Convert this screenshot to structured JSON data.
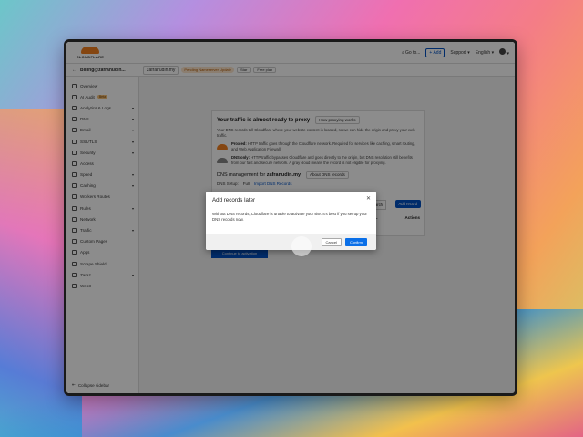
{
  "header": {
    "brand": "CLOUDFLARE",
    "goto": "Go to...",
    "add": "+ Add",
    "support": "Support",
    "language": "English"
  },
  "subbar": {
    "account": "Billing@zafranudin...",
    "zone": "zafranudin.my",
    "status": "Pending Nameserver Update",
    "star": "Star",
    "plan": "Free plan"
  },
  "sidebar": {
    "items": [
      {
        "label": "Overview",
        "caret": false
      },
      {
        "label": "AI Audit",
        "badge": "Beta",
        "caret": false
      },
      {
        "label": "Analytics & Logs",
        "caret": true
      },
      {
        "label": "DNS",
        "caret": true
      },
      {
        "label": "Email",
        "caret": true
      },
      {
        "label": "SSL/TLS",
        "caret": true
      },
      {
        "label": "Security",
        "caret": true
      },
      {
        "label": "Access",
        "caret": false
      },
      {
        "label": "Speed",
        "caret": true
      },
      {
        "label": "Caching",
        "caret": true
      },
      {
        "label": "Workers Routes",
        "caret": false
      },
      {
        "label": "Rules",
        "caret": true
      },
      {
        "label": "Network",
        "caret": false
      },
      {
        "label": "Traffic",
        "caret": true
      },
      {
        "label": "Custom Pages",
        "caret": false
      },
      {
        "label": "Apps",
        "caret": false
      },
      {
        "label": "Scrape Shield",
        "caret": false
      },
      {
        "label": "Zaraz",
        "caret": true
      },
      {
        "label": "Web3",
        "caret": false
      }
    ],
    "collapse": "Collapse sidebar"
  },
  "card": {
    "title": "Your traffic is almost ready to proxy",
    "title_link": "How proxying works",
    "intro": "Your DNS records tell Cloudflare where your website content is located, so we can hide the origin and proxy your web traffic.",
    "proxied_label": "Proxied:",
    "proxied_text": "HTTP traffic goes through the Cloudflare network. Required for services like caching, smart routing, and Web Application Firewall.",
    "dnsonly_label": "DNS only:",
    "dnsonly_text": "HTTP traffic bypasses Cloudflare and goes directly to the origin, but DNS resolution still benefits from our fast and secure network. A gray cloud means the record is not eligible for proxying.",
    "dns_mgmt_prefix": "DNS management for",
    "dns_mgmt_zone": "zafranudin.my",
    "dns_mgmt_link": "About DNS records",
    "dns_setup_label": "DNS Setup:",
    "dns_setup_value": "Full",
    "import_link": "Import DNS Records",
    "search_label": "Search",
    "add_record": "Add record",
    "col_ttl": "TTL",
    "col_actions": "Actions",
    "continue_activation": "Continue to activation"
  },
  "modal": {
    "title": "Add records later",
    "body": "Without DNS records, Cloudflare is unable to activate your site. It's best if you set up your DNS records now.",
    "cancel": "Cancel",
    "confirm": "Confirm"
  }
}
